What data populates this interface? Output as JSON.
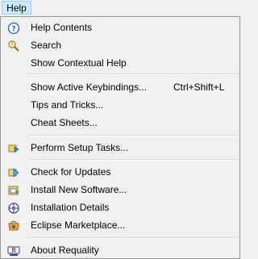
{
  "menubar": {
    "title": "Help"
  },
  "menu": {
    "help_contents": "Help Contents",
    "search": "Search",
    "show_contextual_help": "Show Contextual Help",
    "show_active_keybindings": "Show Active Keybindings...",
    "show_active_keybindings_shortcut": "Ctrl+Shift+L",
    "tips_and_tricks": "Tips and Tricks...",
    "cheat_sheets": "Cheat Sheets...",
    "perform_setup_tasks": "Perform Setup Tasks...",
    "check_for_updates": "Check for Updates",
    "install_new_software": "Install New Software...",
    "installation_details": "Installation Details",
    "eclipse_marketplace": "Eclipse Marketplace...",
    "about_requality": "About Requality"
  },
  "icons": {
    "help_contents": "help-circle-icon",
    "search": "search-help-icon",
    "perform_setup_tasks": "setup-tasks-icon",
    "check_for_updates": "check-updates-icon",
    "install_new_software": "install-software-icon",
    "installation_details": "installation-details-icon",
    "eclipse_marketplace": "marketplace-icon",
    "about_requality": "requality-logo-icon"
  }
}
